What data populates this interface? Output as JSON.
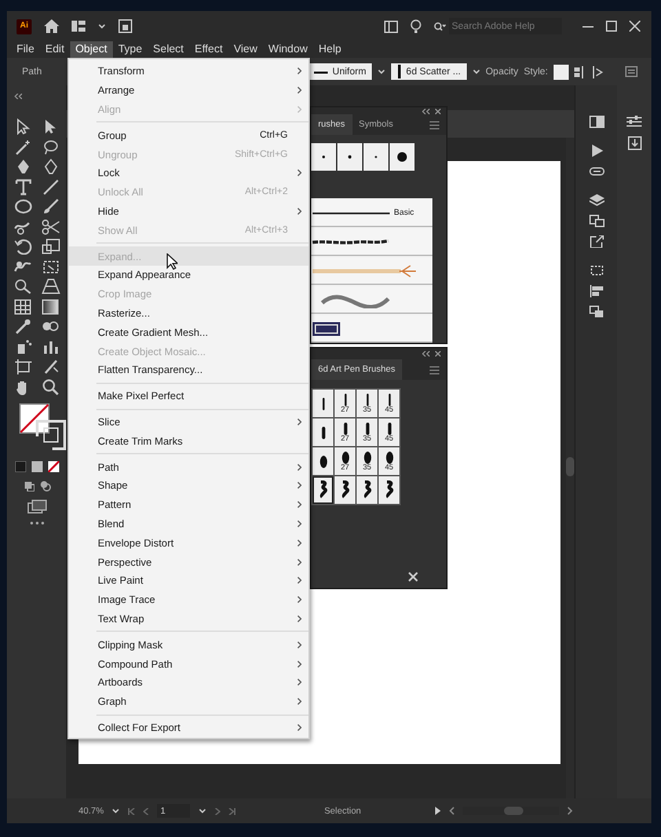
{
  "title_bar": {
    "app_logo": "Ai",
    "search": {
      "placeholder": "Search Adobe Help"
    }
  },
  "menu_bar": [
    {
      "label": "File",
      "selected": false
    },
    {
      "label": "Edit",
      "selected": false
    },
    {
      "label": "Object",
      "selected": true
    },
    {
      "label": "Type",
      "selected": false
    },
    {
      "label": "Select",
      "selected": false
    },
    {
      "label": "Effect",
      "selected": false
    },
    {
      "label": "View",
      "selected": false
    },
    {
      "label": "Window",
      "selected": false
    },
    {
      "label": "Help",
      "selected": false
    }
  ],
  "control_bar": {
    "selection_label": "Path",
    "stroke_profile": "Uniform",
    "brush": "6d Scatter ...",
    "opacity_label": "Opacity",
    "style_label": "Style:"
  },
  "object_menu": {
    "sections": [
      [
        {
          "label": "Transform",
          "submenu": true,
          "disabled": false,
          "highlighted": false
        },
        {
          "label": "Arrange",
          "submenu": true,
          "disabled": false,
          "highlighted": false
        },
        {
          "label": "Align",
          "submenu": true,
          "disabled": true,
          "highlighted": false
        }
      ],
      [
        {
          "label": "Group",
          "shortcut": "Ctrl+G",
          "submenu": false,
          "disabled": false,
          "highlighted": false
        },
        {
          "label": "Ungroup",
          "shortcut": "Shift+Ctrl+G",
          "submenu": false,
          "disabled": true,
          "highlighted": false
        },
        {
          "label": "Lock",
          "submenu": true,
          "disabled": false,
          "highlighted": false
        },
        {
          "label": "Unlock All",
          "shortcut": "Alt+Ctrl+2",
          "submenu": false,
          "disabled": true,
          "highlighted": false
        },
        {
          "label": "Hide",
          "submenu": true,
          "disabled": false,
          "highlighted": false
        },
        {
          "label": "Show All",
          "shortcut": "Alt+Ctrl+3",
          "submenu": false,
          "disabled": true,
          "highlighted": false
        }
      ],
      [
        {
          "label": "Expand...",
          "submenu": false,
          "disabled": true,
          "highlighted": true
        },
        {
          "label": "Expand Appearance",
          "submenu": false,
          "disabled": false,
          "highlighted": false
        },
        {
          "label": "Crop Image",
          "submenu": false,
          "disabled": true,
          "highlighted": false
        },
        {
          "label": "Rasterize...",
          "submenu": false,
          "disabled": false,
          "highlighted": false
        },
        {
          "label": "Create Gradient Mesh...",
          "submenu": false,
          "disabled": false,
          "highlighted": false
        },
        {
          "label": "Create Object Mosaic...",
          "submenu": false,
          "disabled": true,
          "highlighted": false
        },
        {
          "label": "Flatten Transparency...",
          "submenu": false,
          "disabled": false,
          "highlighted": false
        }
      ],
      [
        {
          "label": "Make Pixel Perfect",
          "submenu": false,
          "disabled": false,
          "highlighted": false
        }
      ],
      [
        {
          "label": "Slice",
          "submenu": true,
          "disabled": false,
          "highlighted": false
        },
        {
          "label": "Create Trim Marks",
          "submenu": false,
          "disabled": false,
          "highlighted": false
        }
      ],
      [
        {
          "label": "Path",
          "submenu": true,
          "disabled": false,
          "highlighted": false
        },
        {
          "label": "Shape",
          "submenu": true,
          "disabled": false,
          "highlighted": false
        },
        {
          "label": "Pattern",
          "submenu": true,
          "disabled": false,
          "highlighted": false
        },
        {
          "label": "Blend",
          "submenu": true,
          "disabled": false,
          "highlighted": false
        },
        {
          "label": "Envelope Distort",
          "submenu": true,
          "disabled": false,
          "highlighted": false
        },
        {
          "label": "Perspective",
          "submenu": true,
          "disabled": false,
          "highlighted": false
        },
        {
          "label": "Live Paint",
          "submenu": true,
          "disabled": false,
          "highlighted": false
        },
        {
          "label": "Image Trace",
          "submenu": true,
          "disabled": false,
          "highlighted": false
        },
        {
          "label": "Text Wrap",
          "submenu": true,
          "disabled": false,
          "highlighted": false
        }
      ],
      [
        {
          "label": "Clipping Mask",
          "submenu": true,
          "disabled": false,
          "highlighted": false
        },
        {
          "label": "Compound Path",
          "submenu": true,
          "disabled": false,
          "highlighted": false
        },
        {
          "label": "Artboards",
          "submenu": true,
          "disabled": false,
          "highlighted": false
        },
        {
          "label": "Graph",
          "submenu": true,
          "disabled": false,
          "highlighted": false
        }
      ],
      [
        {
          "label": "Collect For Export",
          "submenu": true,
          "disabled": false,
          "highlighted": false
        }
      ]
    ]
  },
  "brushes_panel": {
    "tabs": [
      {
        "label": "rushes",
        "selected": true
      },
      {
        "label": "Symbols",
        "selected": false
      }
    ],
    "brush_list": [
      {
        "kind": "basic",
        "label": "Basic"
      },
      {
        "kind": "charcoal"
      },
      {
        "kind": "arrow"
      },
      {
        "kind": "wave"
      },
      {
        "kind": "pattern"
      }
    ]
  },
  "art_pen_panel": {
    "tabs": [
      {
        "label": "6d Art Pen Brushes",
        "selected": true
      }
    ],
    "cells": [
      {
        "kind": "thin",
        "selected": false
      },
      {
        "kind": "thin",
        "label": "27",
        "selected": false
      },
      {
        "kind": "thin",
        "label": "35",
        "selected": false
      },
      {
        "kind": "thin",
        "label": "45",
        "selected": false
      },
      {
        "kind": "medium",
        "selected": false
      },
      {
        "kind": "medium",
        "label": "27",
        "selected": false
      },
      {
        "kind": "medium",
        "label": "35",
        "selected": false
      },
      {
        "kind": "medium",
        "label": "45",
        "selected": false
      },
      {
        "kind": "thick",
        "selected": false
      },
      {
        "kind": "thick",
        "label": "27",
        "selected": false
      },
      {
        "kind": "thick",
        "label": "35",
        "selected": false
      },
      {
        "kind": "thick",
        "label": "45",
        "selected": false
      },
      {
        "kind": "scribble",
        "selected": true
      },
      {
        "kind": "scribble",
        "selected": false
      },
      {
        "kind": "scribble",
        "selected": false
      },
      {
        "kind": "scribble",
        "selected": false
      }
    ]
  },
  "status_bar": {
    "zoom": "40.7%",
    "artboard": "1",
    "tool": "Selection"
  }
}
